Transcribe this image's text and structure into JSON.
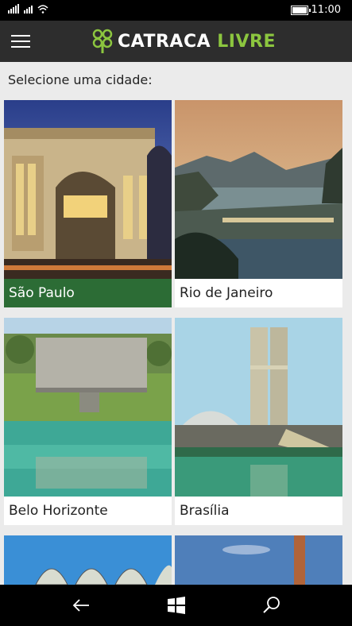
{
  "status": {
    "time": "11:00"
  },
  "app": {
    "logo_part1": "CATRACA",
    "logo_part2": "LIVRE"
  },
  "prompt": "Selecione uma cidade:",
  "cities": [
    {
      "name": "São Paulo"
    },
    {
      "name": "Rio de Janeiro"
    },
    {
      "name": "Belo Horizonte"
    },
    {
      "name": "Brasília"
    }
  ],
  "icons": {
    "menu": "hamburger-menu-icon",
    "back": "back-arrow-icon",
    "home": "windows-start-icon",
    "search": "search-icon"
  },
  "colors": {
    "selected": "#2c6c35",
    "brand_green": "#8cc63f",
    "appbar": "#2d2d2d"
  }
}
